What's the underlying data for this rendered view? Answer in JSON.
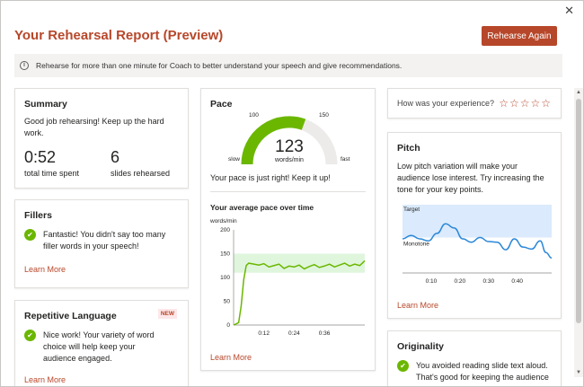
{
  "window": {
    "close_glyph": "✕"
  },
  "header": {
    "title": "Your Rehearsal Report (Preview)",
    "rehearse_button": "Rehearse Again"
  },
  "info_bar": {
    "icon": "i",
    "text": "Rehearse for more than one minute for Coach to better understand your speech and give recommendations."
  },
  "summary": {
    "title": "Summary",
    "message": "Good job rehearsing! Keep up the hard work.",
    "time_value": "0:52",
    "time_label": "total time spent",
    "slides_value": "6",
    "slides_label": "slides rehearsed"
  },
  "fillers": {
    "title": "Fillers",
    "message": "Fantastic! You didn't say too many filler words in your speech!",
    "link": "Learn More"
  },
  "repetitive": {
    "title": "Repetitive Language",
    "badge": "NEW",
    "message": "Nice work! Your variety of word choice will help keep your audience engaged.",
    "link": "Learn More"
  },
  "pace": {
    "title": "Pace",
    "gauge_value": "123",
    "gauge_unit": "words/min",
    "tick_100": "100",
    "tick_150": "150",
    "slow_label": "slow",
    "fast_label": "fast",
    "message": "Your pace is just right! Keep it up!",
    "chart_title": "Your average pace over time",
    "link": "Learn More"
  },
  "experience": {
    "question": "How was your experience?",
    "stars": "☆☆☆☆☆"
  },
  "pitch": {
    "title": "Pitch",
    "message": "Low pitch variation will make your audience lose interest. Try increasing the tone for your key points.",
    "target_label": "Target",
    "monotone_label": "Monotone",
    "link": "Learn More"
  },
  "originality": {
    "title": "Originality",
    "message": "You avoided reading slide text aloud. That's good for keeping the audience"
  },
  "colors": {
    "accent": "#b7472a",
    "good": "#6bb700",
    "gauge_track": "#edebe9",
    "target_band": "#dbeafc",
    "pace_band": "#dff6dd",
    "line_green": "#6bb700",
    "line_blue": "#2b88d8"
  },
  "chart_data": [
    {
      "type": "line",
      "title": "Your average pace over time",
      "ylabel": "words/min",
      "yticks": [
        0,
        50,
        100,
        150,
        200
      ],
      "ylim": [
        0,
        200
      ],
      "xticks": [
        "0:12",
        "0:24",
        "0:36"
      ],
      "x_seconds_ticks": [
        12,
        24,
        36
      ],
      "xlim": [
        0,
        52
      ],
      "target_band": [
        110,
        150
      ],
      "series": [
        {
          "x": [
            0,
            2,
            3,
            4,
            5,
            6,
            8,
            10,
            12,
            14,
            16,
            18,
            20,
            22,
            24,
            26,
            28,
            30,
            32,
            34,
            36,
            38,
            40,
            42,
            44,
            46,
            48,
            50,
            52
          ],
          "y": [
            0,
            5,
            40,
            95,
            125,
            130,
            128,
            126,
            129,
            122,
            125,
            128,
            119,
            124,
            122,
            126,
            118,
            123,
            127,
            121,
            124,
            128,
            122,
            126,
            130,
            124,
            128,
            125,
            135
          ]
        }
      ]
    },
    {
      "type": "line",
      "xticks": [
        "0:10",
        "0:20",
        "0:30",
        "0:40"
      ],
      "x_seconds_ticks": [
        10,
        20,
        30,
        40
      ],
      "xlim": [
        0,
        52
      ],
      "ylim": [
        0,
        100
      ],
      "target_band": [
        52,
        100
      ],
      "series": [
        {
          "x": [
            0,
            3,
            6,
            9,
            12,
            15,
            18,
            21,
            24,
            27,
            30,
            33,
            36,
            39,
            42,
            45,
            48,
            50,
            52
          ],
          "y": [
            50,
            55,
            50,
            47,
            58,
            72,
            66,
            50,
            45,
            52,
            46,
            45,
            34,
            50,
            38,
            35,
            47,
            30,
            22
          ]
        }
      ]
    }
  ]
}
